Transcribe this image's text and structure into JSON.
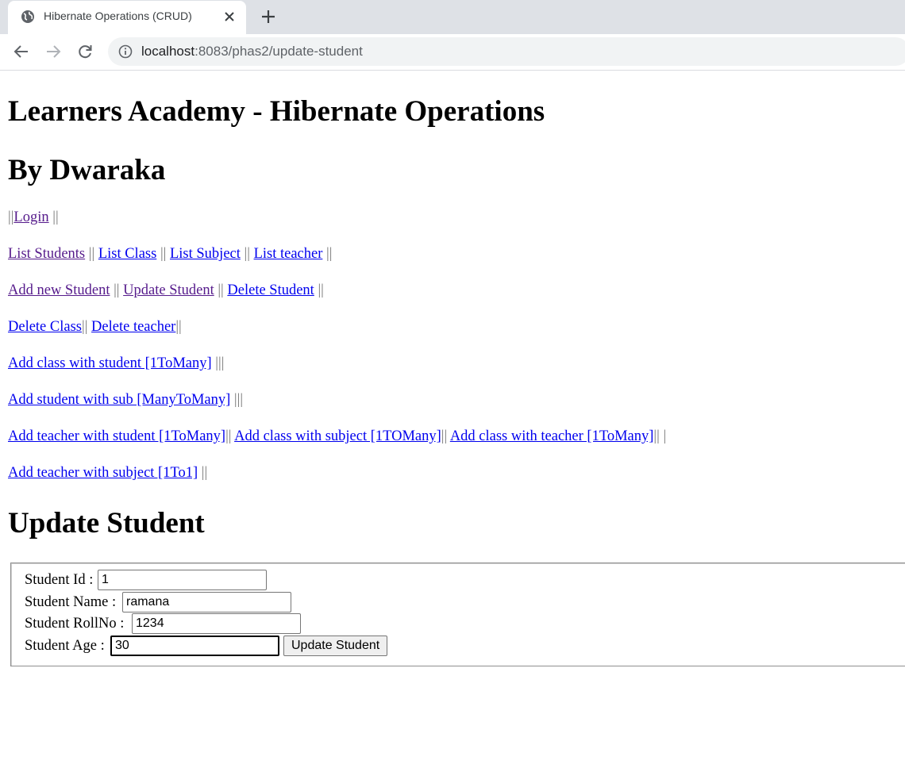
{
  "browser": {
    "tab_title": "Hibernate Operations (CRUD)",
    "url_host": "localhost",
    "url_rest": ":8083/phas2/update-student"
  },
  "page": {
    "title": "Learners Academy - Hibernate Operations",
    "author": "By Dwaraka",
    "nav": {
      "login": "Login",
      "list_students": "List Students",
      "list_class": "List Class",
      "list_subject": "List Subject",
      "list_teacher": "List teacher",
      "add_student": "Add new Student",
      "update_student": "Update Student",
      "delete_student": "Delete Student",
      "delete_class": "Delete Class",
      "delete_teacher": "Delete teacher",
      "add_class_student": "Add class with student [1ToMany]",
      "add_student_sub": "Add student with sub [ManyToMany]",
      "add_teacher_student": "Add teacher with student [1ToMany]",
      "add_class_subject": "Add class with subject [1TOMany]",
      "add_class_teacher": "Add class with teacher [1ToMany]",
      "add_teacher_subject": "Add teacher with subject [1To1]"
    },
    "sep": {
      "double": "||",
      "triple": "|||",
      "spaced_double": " ||",
      "spaced_double_both": " || ",
      "spaced_triple": " |||",
      "end_pipes": "|| |",
      "left_login": "||",
      "right_login": " ||"
    },
    "section_title": "Update Student"
  },
  "form": {
    "id_label": "Student Id :",
    "id_value": "1",
    "name_label": "Student Name :",
    "name_value": "ramana",
    "roll_label": "Student RollNo :",
    "roll_value": "1234",
    "age_label": "Student Age :",
    "age_value": "30",
    "submit_label": "Update Student"
  },
  "colors": {
    "link": "#0000ee",
    "visited": "#551a8b",
    "separator": "#777777"
  }
}
